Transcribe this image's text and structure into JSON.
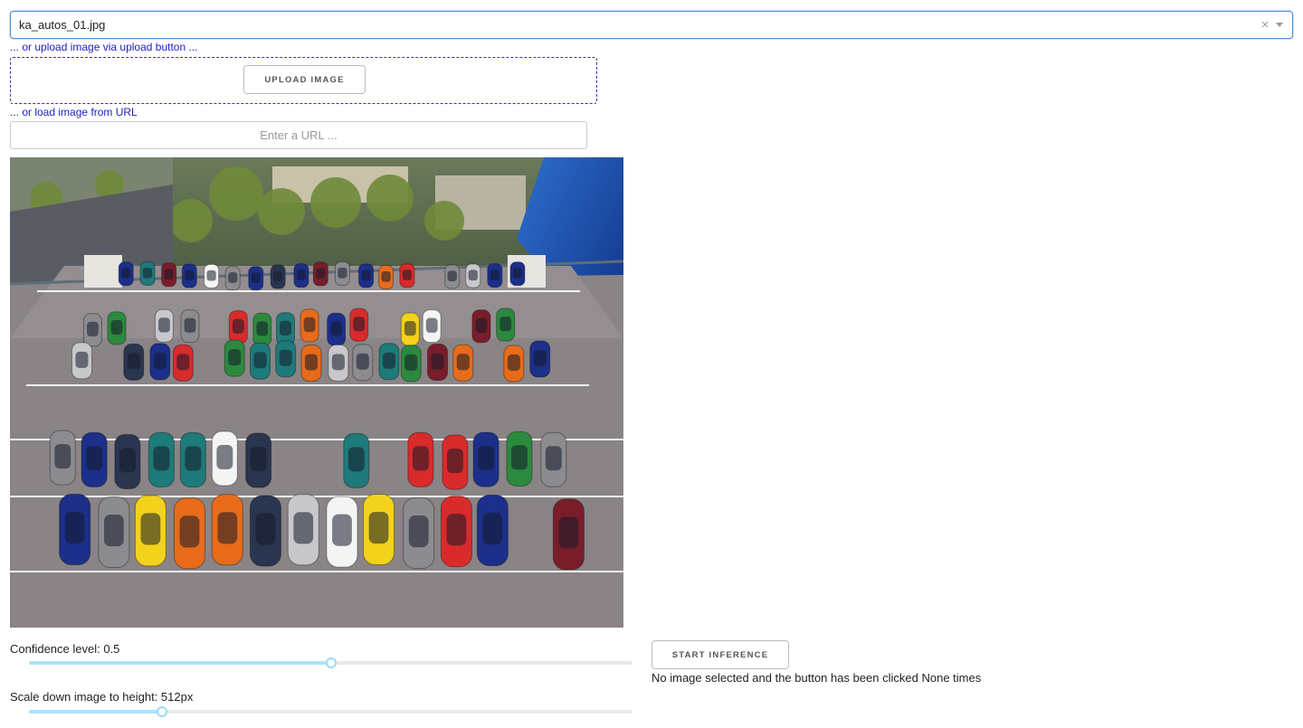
{
  "image_select": {
    "value": "ka_autos_01.jpg",
    "clear_glyph": "×"
  },
  "upload": {
    "hint": "... or upload image via upload button ...",
    "button_label": "UPLOAD IMAGE"
  },
  "url": {
    "hint": "... or load image from URL",
    "value": "",
    "placeholder": "Enter a URL ..."
  },
  "confidence": {
    "label": "Confidence level: 0.5",
    "fraction": 0.5
  },
  "scale": {
    "label": "Scale down image to height: 512px",
    "fraction": 0.22
  },
  "inference": {
    "button_label": "START INFERENCE",
    "status": "No image selected and the button has been clicked None times"
  },
  "colors": {
    "focus_border": "#4a90d9",
    "hint_text": "#2020c8",
    "slider_track": "#abe2fb",
    "slider_handle": "#96dbfa"
  }
}
